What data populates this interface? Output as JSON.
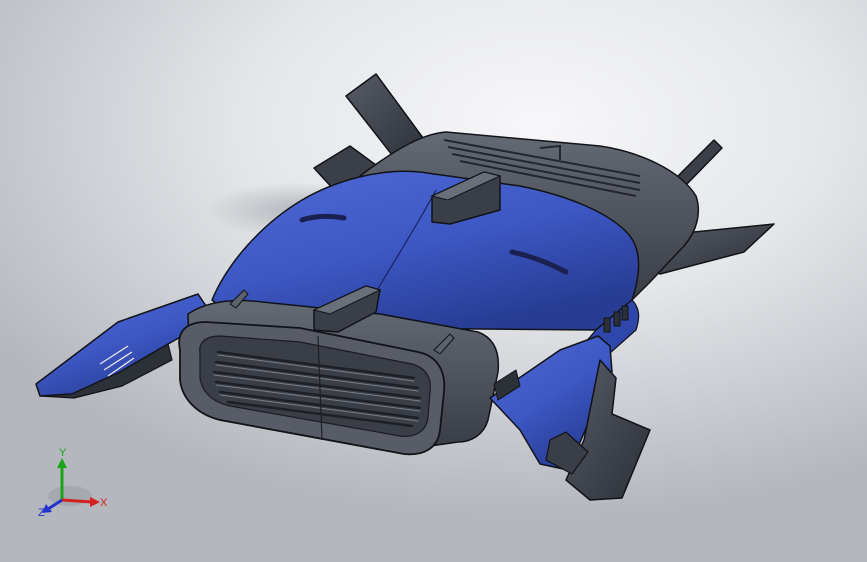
{
  "viewport": {
    "background_top": "#f7f7f9",
    "background_bottom": "#b4b7bd"
  },
  "model": {
    "colors": {
      "blue_body": "#3d57c4",
      "blue_dark": "#273c92",
      "gray_body": "#4e535c",
      "gray_dark": "#2c3037",
      "edge": "#111318"
    }
  },
  "triad": {
    "x_label": "X",
    "y_label": "Y",
    "z_label": "Z",
    "x_color": "#d42020",
    "y_color": "#19a419",
    "z_color": "#2233cc"
  }
}
